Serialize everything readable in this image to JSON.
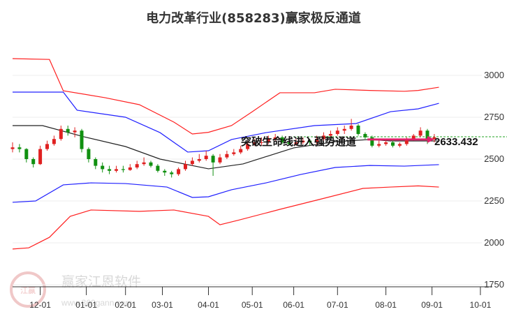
{
  "chart_data": {
    "type": "candlestick",
    "title": "电力改革行业(858283)赢家极反通道",
    "ylim": [
      1750,
      3100
    ],
    "yticks": [
      1750,
      2000,
      2250,
      2500,
      2750,
      3000
    ],
    "xlim": [
      0,
      205
    ],
    "xticks": [
      {
        "i": 12,
        "label": "12-01"
      },
      {
        "i": 32,
        "label": "01-01"
      },
      {
        "i": 49,
        "label": "02-01"
      },
      {
        "i": 65,
        "label": "03-01"
      },
      {
        "i": 85,
        "label": "04-01"
      },
      {
        "i": 104,
        "label": "05-01"
      },
      {
        "i": 122,
        "label": "06-01"
      },
      {
        "i": 141,
        "label": "07-01"
      },
      {
        "i": 162,
        "label": "08-01"
      },
      {
        "i": 182,
        "label": "09-01"
      },
      {
        "i": 203,
        "label": "10-01"
      }
    ],
    "candle_step": 3,
    "candles": [
      [
        2560,
        2600,
        2540,
        2570
      ],
      [
        2570,
        2590,
        2540,
        2560
      ],
      [
        2560,
        2565,
        2480,
        2500
      ],
      [
        2500,
        2510,
        2450,
        2470
      ],
      [
        2470,
        2580,
        2465,
        2560
      ],
      [
        2560,
        2610,
        2550,
        2590
      ],
      [
        2590,
        2640,
        2580,
        2620
      ],
      [
        2620,
        2700,
        2610,
        2680
      ],
      [
        2680,
        2700,
        2640,
        2660
      ],
      [
        2660,
        2690,
        2630,
        2670
      ],
      [
        2670,
        2680,
        2540,
        2560
      ],
      [
        2560,
        2570,
        2480,
        2500
      ],
      [
        2500,
        2510,
        2440,
        2460
      ],
      [
        2460,
        2480,
        2420,
        2440
      ],
      [
        2440,
        2460,
        2410,
        2430
      ],
      [
        2430,
        2460,
        2420,
        2440
      ],
      [
        2440,
        2460,
        2420,
        2435
      ],
      [
        2435,
        2470,
        2430,
        2450
      ],
      [
        2450,
        2490,
        2440,
        2470
      ],
      [
        2470,
        2510,
        2460,
        2480
      ],
      [
        2480,
        2490,
        2450,
        2460
      ],
      [
        2460,
        2470,
        2420,
        2430
      ],
      [
        2430,
        2440,
        2400,
        2420
      ],
      [
        2420,
        2430,
        2390,
        2410
      ],
      [
        2410,
        2450,
        2400,
        2440
      ],
      [
        2440,
        2490,
        2430,
        2470
      ],
      [
        2470,
        2510,
        2460,
        2490
      ],
      [
        2490,
        2530,
        2480,
        2500
      ],
      [
        2500,
        2550,
        2490,
        2520
      ],
      [
        2520,
        2530,
        2400,
        2480
      ],
      [
        2480,
        2530,
        2470,
        2510
      ],
      [
        2510,
        2550,
        2500,
        2530
      ],
      [
        2530,
        2560,
        2520,
        2540
      ],
      [
        2540,
        2580,
        2530,
        2560
      ],
      [
        2560,
        2610,
        2550,
        2590
      ],
      [
        2590,
        2620,
        2580,
        2600
      ],
      [
        2600,
        2630,
        2580,
        2600
      ],
      [
        2600,
        2640,
        2590,
        2620
      ],
      [
        2620,
        2650,
        2610,
        2630
      ],
      [
        2630,
        2640,
        2590,
        2600
      ],
      [
        2600,
        2620,
        2580,
        2590
      ],
      [
        2590,
        2620,
        2580,
        2600
      ],
      [
        2600,
        2630,
        2590,
        2610
      ],
      [
        2610,
        2620,
        2580,
        2600
      ],
      [
        2600,
        2640,
        2590,
        2620
      ],
      [
        2620,
        2660,
        2610,
        2640
      ],
      [
        2640,
        2670,
        2630,
        2650
      ],
      [
        2650,
        2690,
        2640,
        2670
      ],
      [
        2670,
        2700,
        2650,
        2680
      ],
      [
        2680,
        2740,
        2670,
        2700
      ],
      [
        2700,
        2710,
        2640,
        2650
      ],
      [
        2650,
        2660,
        2620,
        2630
      ],
      [
        2630,
        2640,
        2570,
        2580
      ],
      [
        2580,
        2610,
        2570,
        2590
      ],
      [
        2590,
        2620,
        2580,
        2600
      ],
      [
        2600,
        2610,
        2570,
        2580
      ],
      [
        2580,
        2600,
        2570,
        2590
      ],
      [
        2590,
        2630,
        2580,
        2620
      ],
      [
        2620,
        2650,
        2610,
        2640
      ],
      [
        2640,
        2690,
        2630,
        2670
      ],
      [
        2670,
        2680,
        2590,
        2620
      ],
      [
        2620,
        2650,
        2600,
        2630
      ]
    ],
    "channels": [
      {
        "name": "upper-outer",
        "color": "#ff2020",
        "points": [
          [
            0,
            3100
          ],
          [
            16,
            3095
          ],
          [
            22,
            2908
          ],
          [
            40,
            2867
          ],
          [
            55,
            2825
          ],
          [
            70,
            2721
          ],
          [
            78,
            2650
          ],
          [
            85,
            2660
          ],
          [
            95,
            2700
          ],
          [
            104,
            2783
          ],
          [
            116,
            2896
          ],
          [
            131,
            2896
          ],
          [
            140,
            2917
          ],
          [
            155,
            2910
          ],
          [
            170,
            2905
          ],
          [
            176,
            2910
          ],
          [
            185,
            2929
          ]
        ]
      },
      {
        "name": "upper-inner",
        "color": "#2020ff",
        "points": [
          [
            0,
            2900
          ],
          [
            22,
            2900
          ],
          [
            28,
            2792
          ],
          [
            49,
            2750
          ],
          [
            64,
            2658
          ],
          [
            76,
            2542
          ],
          [
            85,
            2550
          ],
          [
            95,
            2617
          ],
          [
            110,
            2658
          ],
          [
            131,
            2700
          ],
          [
            149,
            2712
          ],
          [
            164,
            2783
          ],
          [
            176,
            2800
          ],
          [
            185,
            2833
          ]
        ]
      },
      {
        "name": "middle",
        "color": "#222222",
        "points": [
          [
            0,
            2700
          ],
          [
            13,
            2700
          ],
          [
            31,
            2633
          ],
          [
            49,
            2575
          ],
          [
            64,
            2500
          ],
          [
            85,
            2442
          ],
          [
            100,
            2471
          ],
          [
            122,
            2567
          ],
          [
            140,
            2604
          ],
          [
            155,
            2617
          ],
          [
            164,
            2608
          ],
          [
            185,
            2608
          ]
        ]
      },
      {
        "name": "lower-inner",
        "color": "#2020ff",
        "points": [
          [
            0,
            2242
          ],
          [
            10,
            2250
          ],
          [
            22,
            2346
          ],
          [
            34,
            2358
          ],
          [
            49,
            2354
          ],
          [
            67,
            2333
          ],
          [
            78,
            2271
          ],
          [
            85,
            2275
          ],
          [
            95,
            2317
          ],
          [
            110,
            2358
          ],
          [
            125,
            2408
          ],
          [
            140,
            2450
          ],
          [
            155,
            2462
          ],
          [
            170,
            2458
          ],
          [
            185,
            2467
          ]
        ]
      },
      {
        "name": "lower-outer",
        "color": "#ff2020",
        "points": [
          [
            0,
            1963
          ],
          [
            7,
            1970
          ],
          [
            16,
            2033
          ],
          [
            25,
            2158
          ],
          [
            34,
            2196
          ],
          [
            55,
            2188
          ],
          [
            70,
            2196
          ],
          [
            85,
            2158
          ],
          [
            90,
            2108
          ],
          [
            98,
            2135
          ],
          [
            116,
            2200
          ],
          [
            134,
            2262
          ],
          [
            152,
            2325
          ],
          [
            164,
            2333
          ],
          [
            176,
            2340
          ],
          [
            185,
            2333
          ]
        ]
      }
    ],
    "last_price": 2633.432,
    "last_price_label": "2633.432",
    "annotation": "突破生命线进入强势通道",
    "arrow": {
      "from": [
        154,
        2617
      ],
      "to": [
        183,
        2617
      ]
    },
    "colors": {
      "up": "#e02020",
      "down": "#109010",
      "ref_line": "#20a020",
      "arrow": "#e0206a"
    }
  },
  "watermark": {
    "brand": "赢家江恩软件",
    "url": "www.360gann.com",
    "seal": "江赢恩家"
  }
}
